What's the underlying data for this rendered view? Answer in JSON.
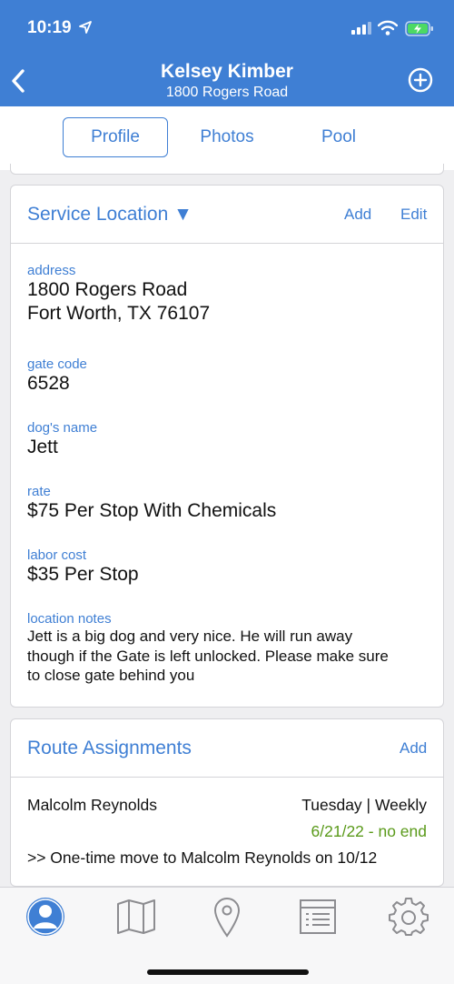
{
  "status": {
    "time": "10:19"
  },
  "nav": {
    "title": "Kelsey Kimber",
    "subtitle": "1800 Rogers Road"
  },
  "tabs": [
    {
      "label": "Profile"
    },
    {
      "label": "Photos"
    },
    {
      "label": "Pool"
    }
  ],
  "service_location": {
    "title": "Service Location ▼",
    "add_label": "Add",
    "edit_label": "Edit",
    "fields": [
      {
        "label": "address",
        "lines": [
          "1800 Rogers Road",
          "Fort Worth, TX 76107"
        ]
      },
      {
        "label": "gate code",
        "value": "6528"
      },
      {
        "label": "dog's name",
        "value": "Jett"
      },
      {
        "label": "rate",
        "value": "$75 Per Stop With Chemicals"
      },
      {
        "label": "labor cost",
        "value": "$35 Per Stop"
      },
      {
        "label": "location notes",
        "lines": [
          "Jett is a big dog and very nice. He will run away",
          "though if the Gate is left unlocked. Please make sure",
          "to close gate behind you"
        ]
      }
    ]
  },
  "route_assignments": {
    "title": "Route Assignments",
    "add_label": "Add",
    "tech": "Malcolm Reynolds",
    "schedule": "Tuesday | Weekly",
    "date_range": "6/21/22 - no end",
    "move_note": ">> One-time move to Malcolm Reynolds on 10/12"
  },
  "bottom_nav": [
    "profile-icon",
    "map-icon",
    "location-pin-icon",
    "list-icon",
    "settings-icon"
  ],
  "colors": {
    "brand": "#3f7fd4",
    "date_green": "#5a9a1a",
    "battery": "#4cd964"
  }
}
